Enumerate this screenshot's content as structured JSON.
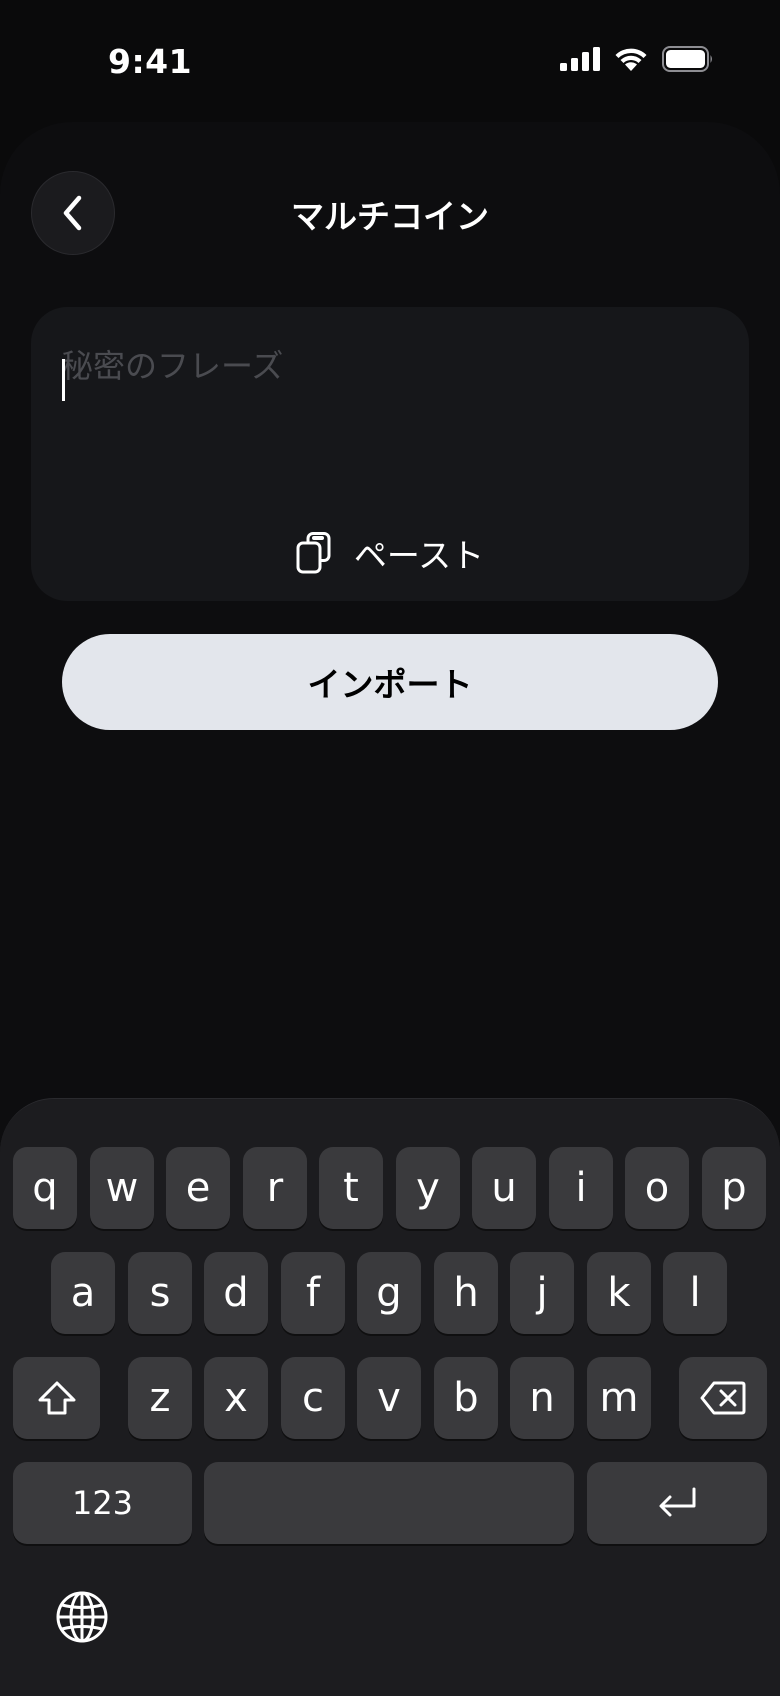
{
  "status_bar": {
    "time": "9:41",
    "icons": [
      "signal-icon",
      "wifi-icon",
      "battery-icon"
    ]
  },
  "header": {
    "title": "マルチコイン",
    "back_icon": "chevron-left-icon"
  },
  "phrase_input": {
    "placeholder": "秘密のフレーズ",
    "value": ""
  },
  "paste": {
    "label": "ペースト",
    "icon": "clipboard-icon"
  },
  "import_button": {
    "label": "インポート"
  },
  "keyboard": {
    "row1": [
      "q",
      "w",
      "e",
      "r",
      "t",
      "y",
      "u",
      "i",
      "o",
      "p"
    ],
    "row2": [
      "a",
      "s",
      "d",
      "f",
      "g",
      "h",
      "j",
      "k",
      "l"
    ],
    "row3": [
      "z",
      "x",
      "c",
      "v",
      "b",
      "n",
      "m"
    ],
    "numbers_key": "123",
    "space_key": "",
    "shift_icon": "shift-icon",
    "delete_icon": "delete-icon",
    "return_icon": "return-icon",
    "globe_icon": "globe-icon"
  },
  "colors": {
    "background": "#0a0a0b",
    "sheet": "#0d0d0f",
    "input_box": "#16171a",
    "import_button": "#e3e6ec",
    "keyboard": "#1c1c1f",
    "key": "#3a3a3d"
  }
}
